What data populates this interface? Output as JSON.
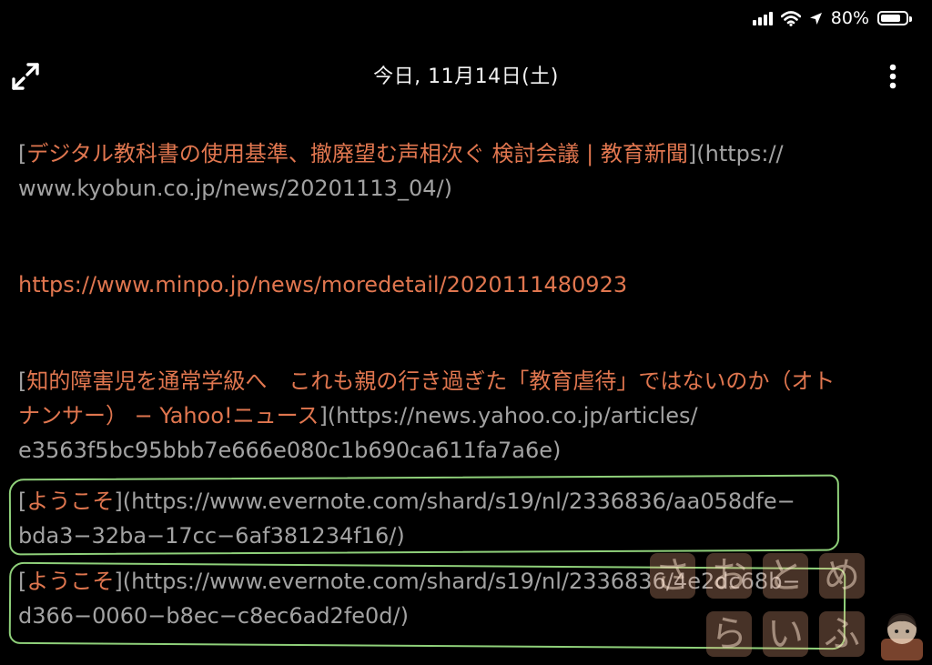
{
  "status_bar": {
    "battery_text": "80%",
    "battery_level": 0.8
  },
  "header": {
    "title": "今日, 11月14日(土)"
  },
  "note": {
    "p1": {
      "open": "[",
      "link": "デジタル教科書の使用基準、撤廃望む声相次ぐ 検討会議 | 教育新聞",
      "mid": "](",
      "url_line1": "https://",
      "url_line2": "www.kyobun.co.jp/news/20201113_04/",
      "close": ")"
    },
    "p2": {
      "url": "https://www.minpo.jp/news/moredetail/2020111480923"
    },
    "p3": {
      "open": "[",
      "link_line1": "知的障害児を通常学級へ　これも親の行き過ぎた「教育虐待」ではないのか（オト",
      "link_line2": "ナンサー） − Yahoo!ニュース",
      "mid": "](",
      "url_line2": "https://news.yahoo.co.jp/articles/",
      "url_line3": "e3563f5bc95bbb7e666e080c1b690ca611fa7a6e",
      "close": ")"
    },
    "p4": {
      "open": "[",
      "link": "ようこそ",
      "mid": "](",
      "url_line1": "https://www.evernote.com/shard/s19/nl/2336836/aa058dfe−",
      "url_line2": "bda3−32ba−17cc−6af381234f16/",
      "close": ")"
    },
    "p5": {
      "open": "[",
      "link": "ようこそ",
      "mid": "](",
      "url_line1": "https://www.evernote.com/shard/s19/nl/2336836/4e2dc68b−",
      "url_line2": "d366−0060−b8ec−c8ec6ad2fe0d/",
      "close": ")"
    }
  },
  "watermark": {
    "row1": [
      "さ",
      "お",
      "と",
      "め"
    ],
    "row2": [
      "ら",
      "い",
      "ふ"
    ]
  },
  "colors": {
    "link": "#e0764f",
    "text": "#a2a2a2",
    "highlight": "#8fd07a",
    "background": "#000000"
  },
  "icons": {
    "expand": "expand-icon",
    "more": "more-vertical-icon",
    "wifi": "wifi-icon",
    "location": "location-arrow-icon",
    "signal": "signal-icon",
    "battery": "battery-icon"
  }
}
